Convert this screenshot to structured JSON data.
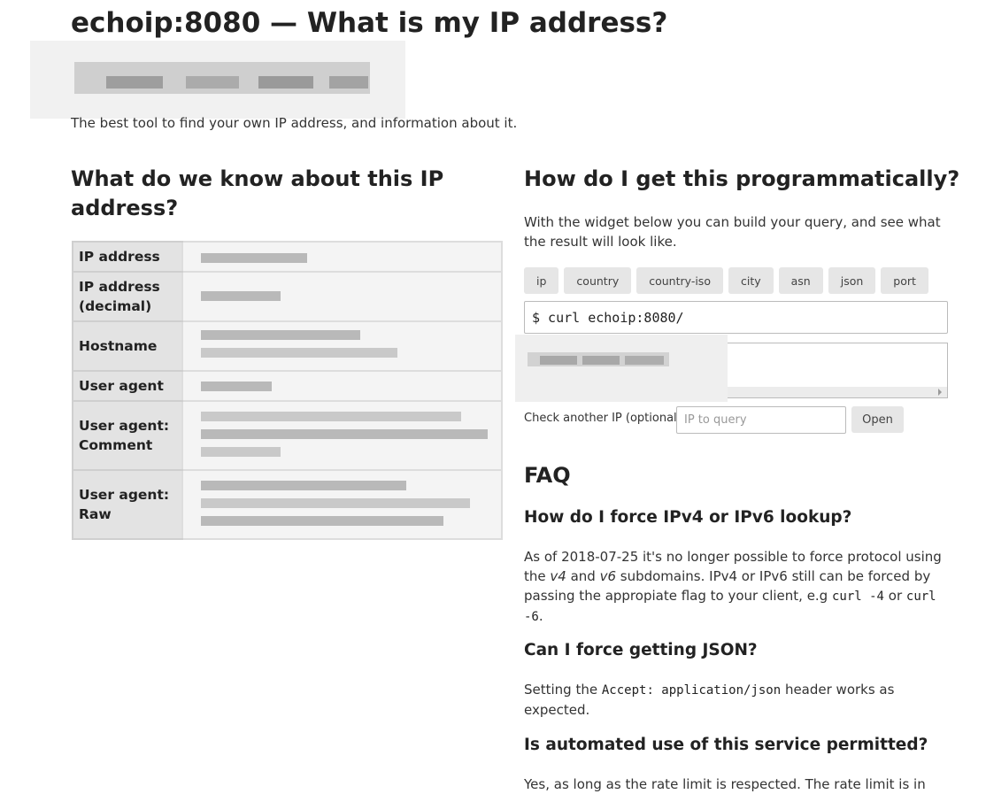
{
  "page": {
    "title": "echoip:8080 — What is my IP address?",
    "subtitle": "The best tool to find your own IP address, and information about it."
  },
  "info": {
    "heading": "What do we know about this IP address?",
    "rows": [
      {
        "label": "IP address"
      },
      {
        "label": "IP address (decimal)"
      },
      {
        "label": "Hostname"
      },
      {
        "label": "User agent"
      },
      {
        "label": "User agent: Comment"
      },
      {
        "label": "User agent: Raw"
      }
    ]
  },
  "api": {
    "heading": "How do I get this programmatically?",
    "description": "With the widget below you can build your query, and see what the result will look like.",
    "options": [
      "ip",
      "country",
      "country-iso",
      "city",
      "asn",
      "json",
      "port"
    ],
    "command": "$ curl echoip:8080/",
    "check_label": "Check another IP (optional)",
    "check_placeholder": "IP to query",
    "open_label": "Open"
  },
  "faq": {
    "heading": "FAQ",
    "q1": "How do I force IPv4 or IPv6 lookup?",
    "a1_part1": "As of 2018-07-25 it's no longer possible to force protocol using the ",
    "a1_v4": "v4",
    "a1_and": " and ",
    "a1_v6": "v6",
    "a1_part2": " subdomains. IPv4 or IPv6 still can be forced by passing the appropiate flag to your client, e.g ",
    "a1_code1": "curl -4",
    "a1_or": " or ",
    "a1_code2": "curl -6",
    "a1_end": ".",
    "q2": "Can I force getting JSON?",
    "a2_part1": "Setting the ",
    "a2_code": "Accept: application/json",
    "a2_part2": " header works as expected.",
    "q3": "Is automated use of this service permitted?",
    "a3": "Yes, as long as the rate limit is respected. The rate limit is in"
  },
  "colors": {
    "label_bg": "#e3e3e3",
    "value_bg": "#f4f4f4",
    "button_bg": "#e6e6e6"
  }
}
